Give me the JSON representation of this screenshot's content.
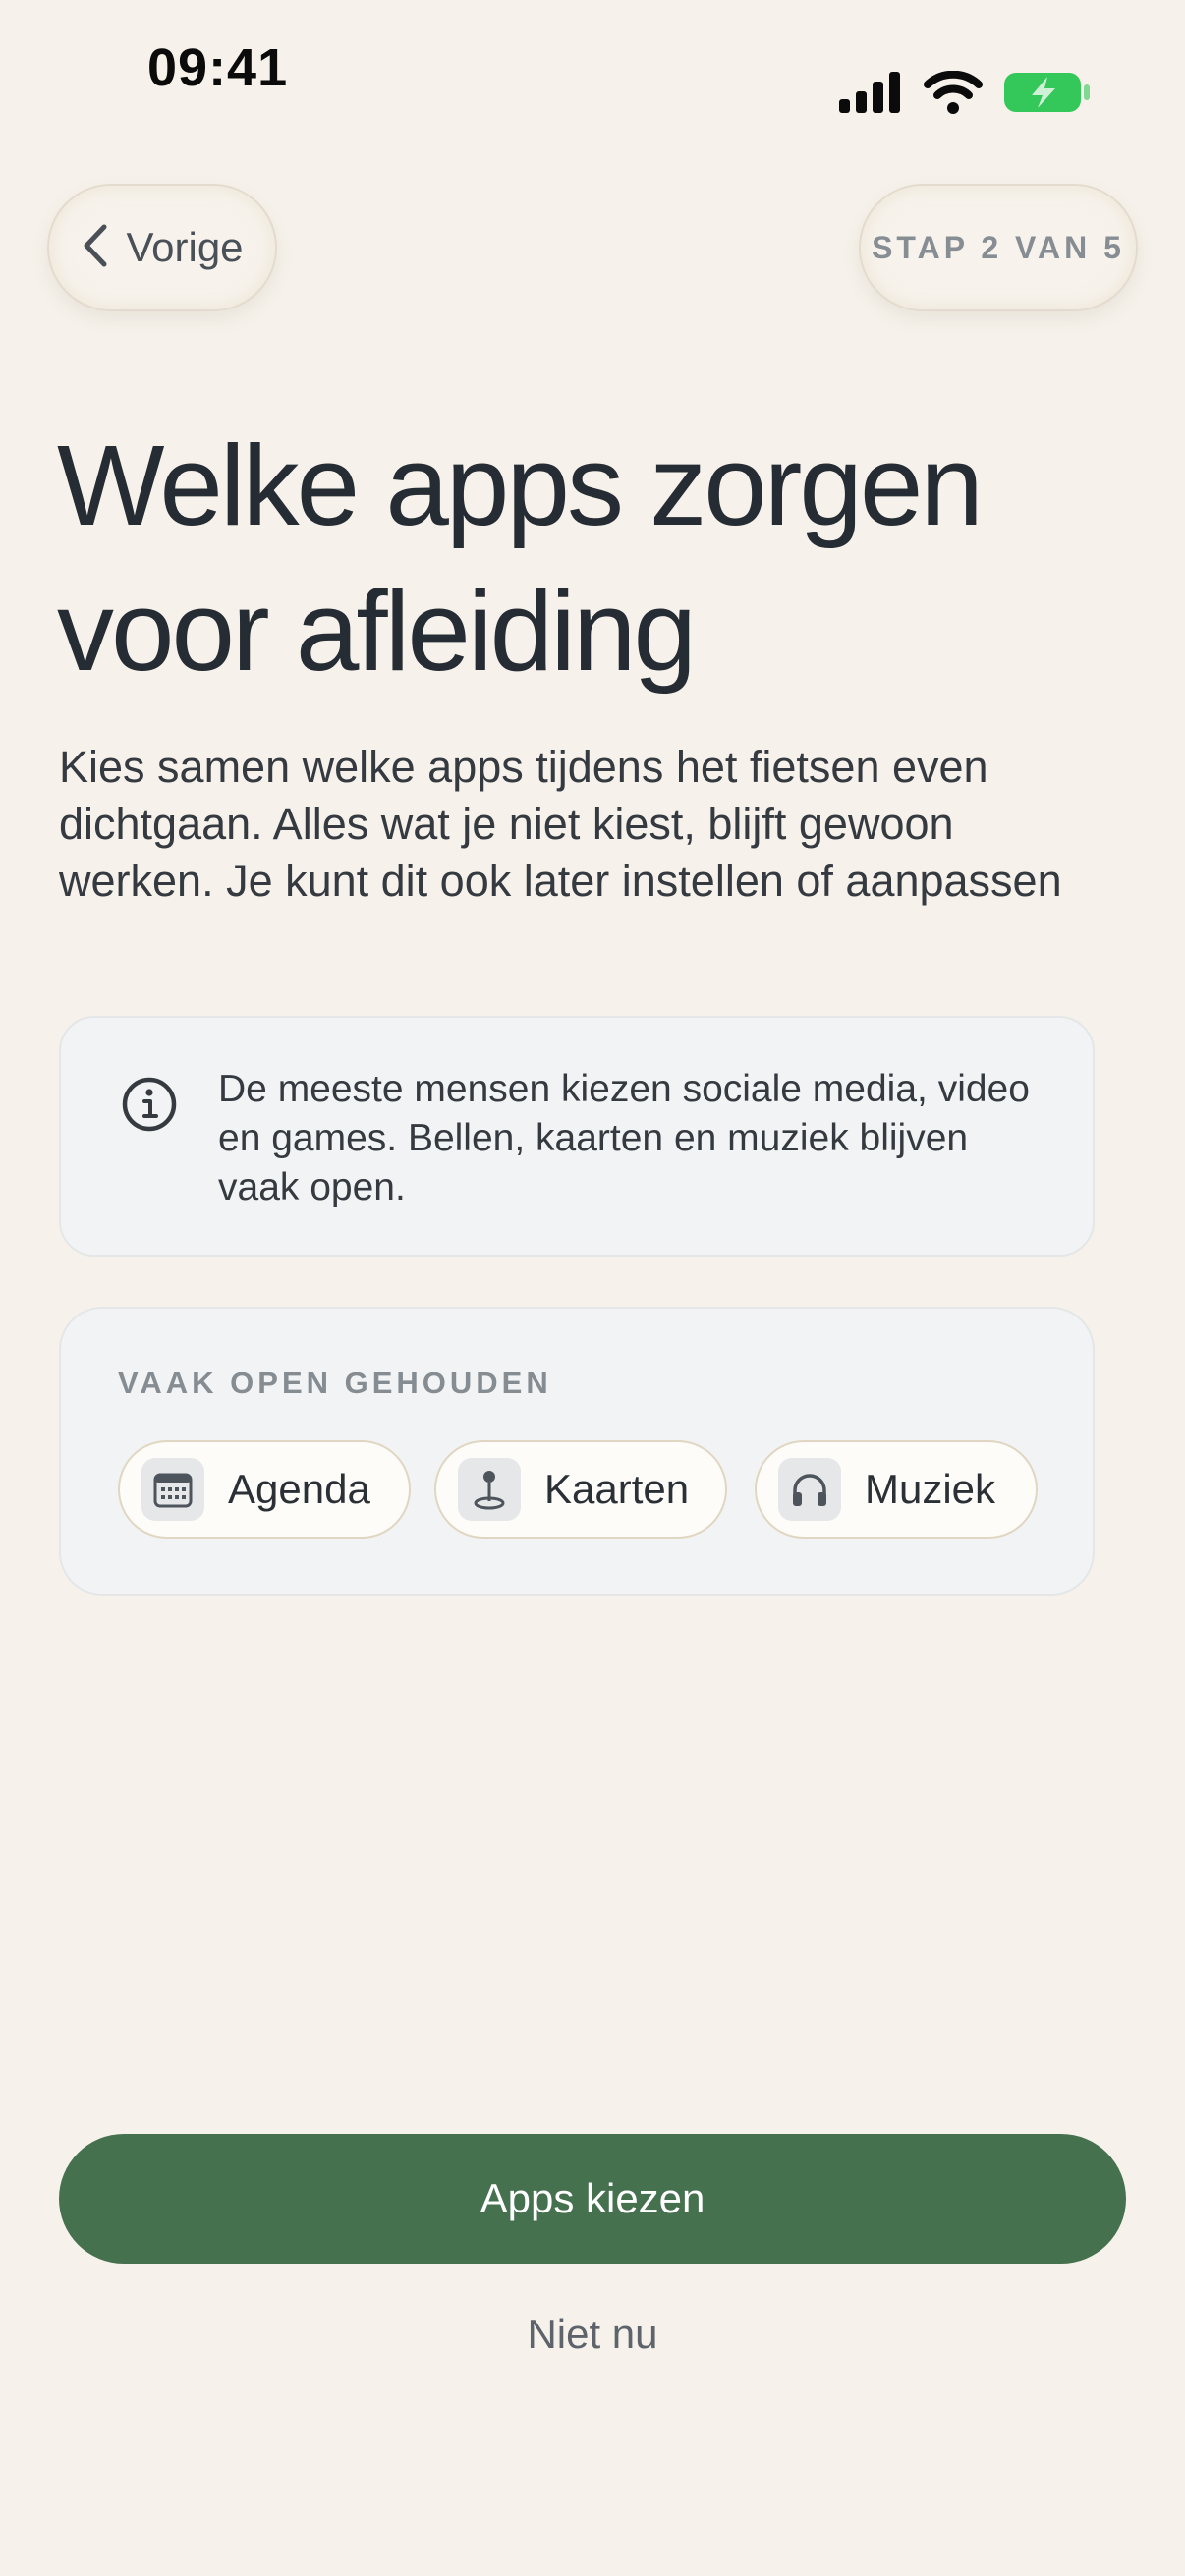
{
  "status_bar": {
    "time": "09:41",
    "icons": [
      "cellular-signal-icon",
      "wifi-icon",
      "battery-charging-icon"
    ],
    "battery_color": "#34c759"
  },
  "nav": {
    "back_label": "Vorige",
    "back_icon": "chevron-left-icon",
    "step_label": "STAP 2 VAN 5"
  },
  "main": {
    "title": "Welke apps zorgen voor afleiding",
    "description": "Kies samen welke apps tijdens het fietsen even dichtgaan. Alles wat je niet kiest, blijft gewoon werken. Je kunt dit ook later instellen of aanpassen"
  },
  "info_card": {
    "icon": "info-icon",
    "text": "De meeste mensen kiezen sociale media, video en games. Bellen, kaarten en muziek blijven vaak open."
  },
  "often_open": {
    "heading": "VAAK OPEN GEHOUDEN",
    "chips": [
      {
        "label": "Agenda",
        "icon": "calendar-icon"
      },
      {
        "label": "Kaarten",
        "icon": "map-pin-icon"
      },
      {
        "label": "Muziek",
        "icon": "headphones-icon"
      }
    ]
  },
  "actions": {
    "primary_label": "Apps kiezen",
    "secondary_label": "Niet nu"
  },
  "colors": {
    "background": "#f6f2eb",
    "accent": "#46714f",
    "card": "#f2f3f4"
  }
}
